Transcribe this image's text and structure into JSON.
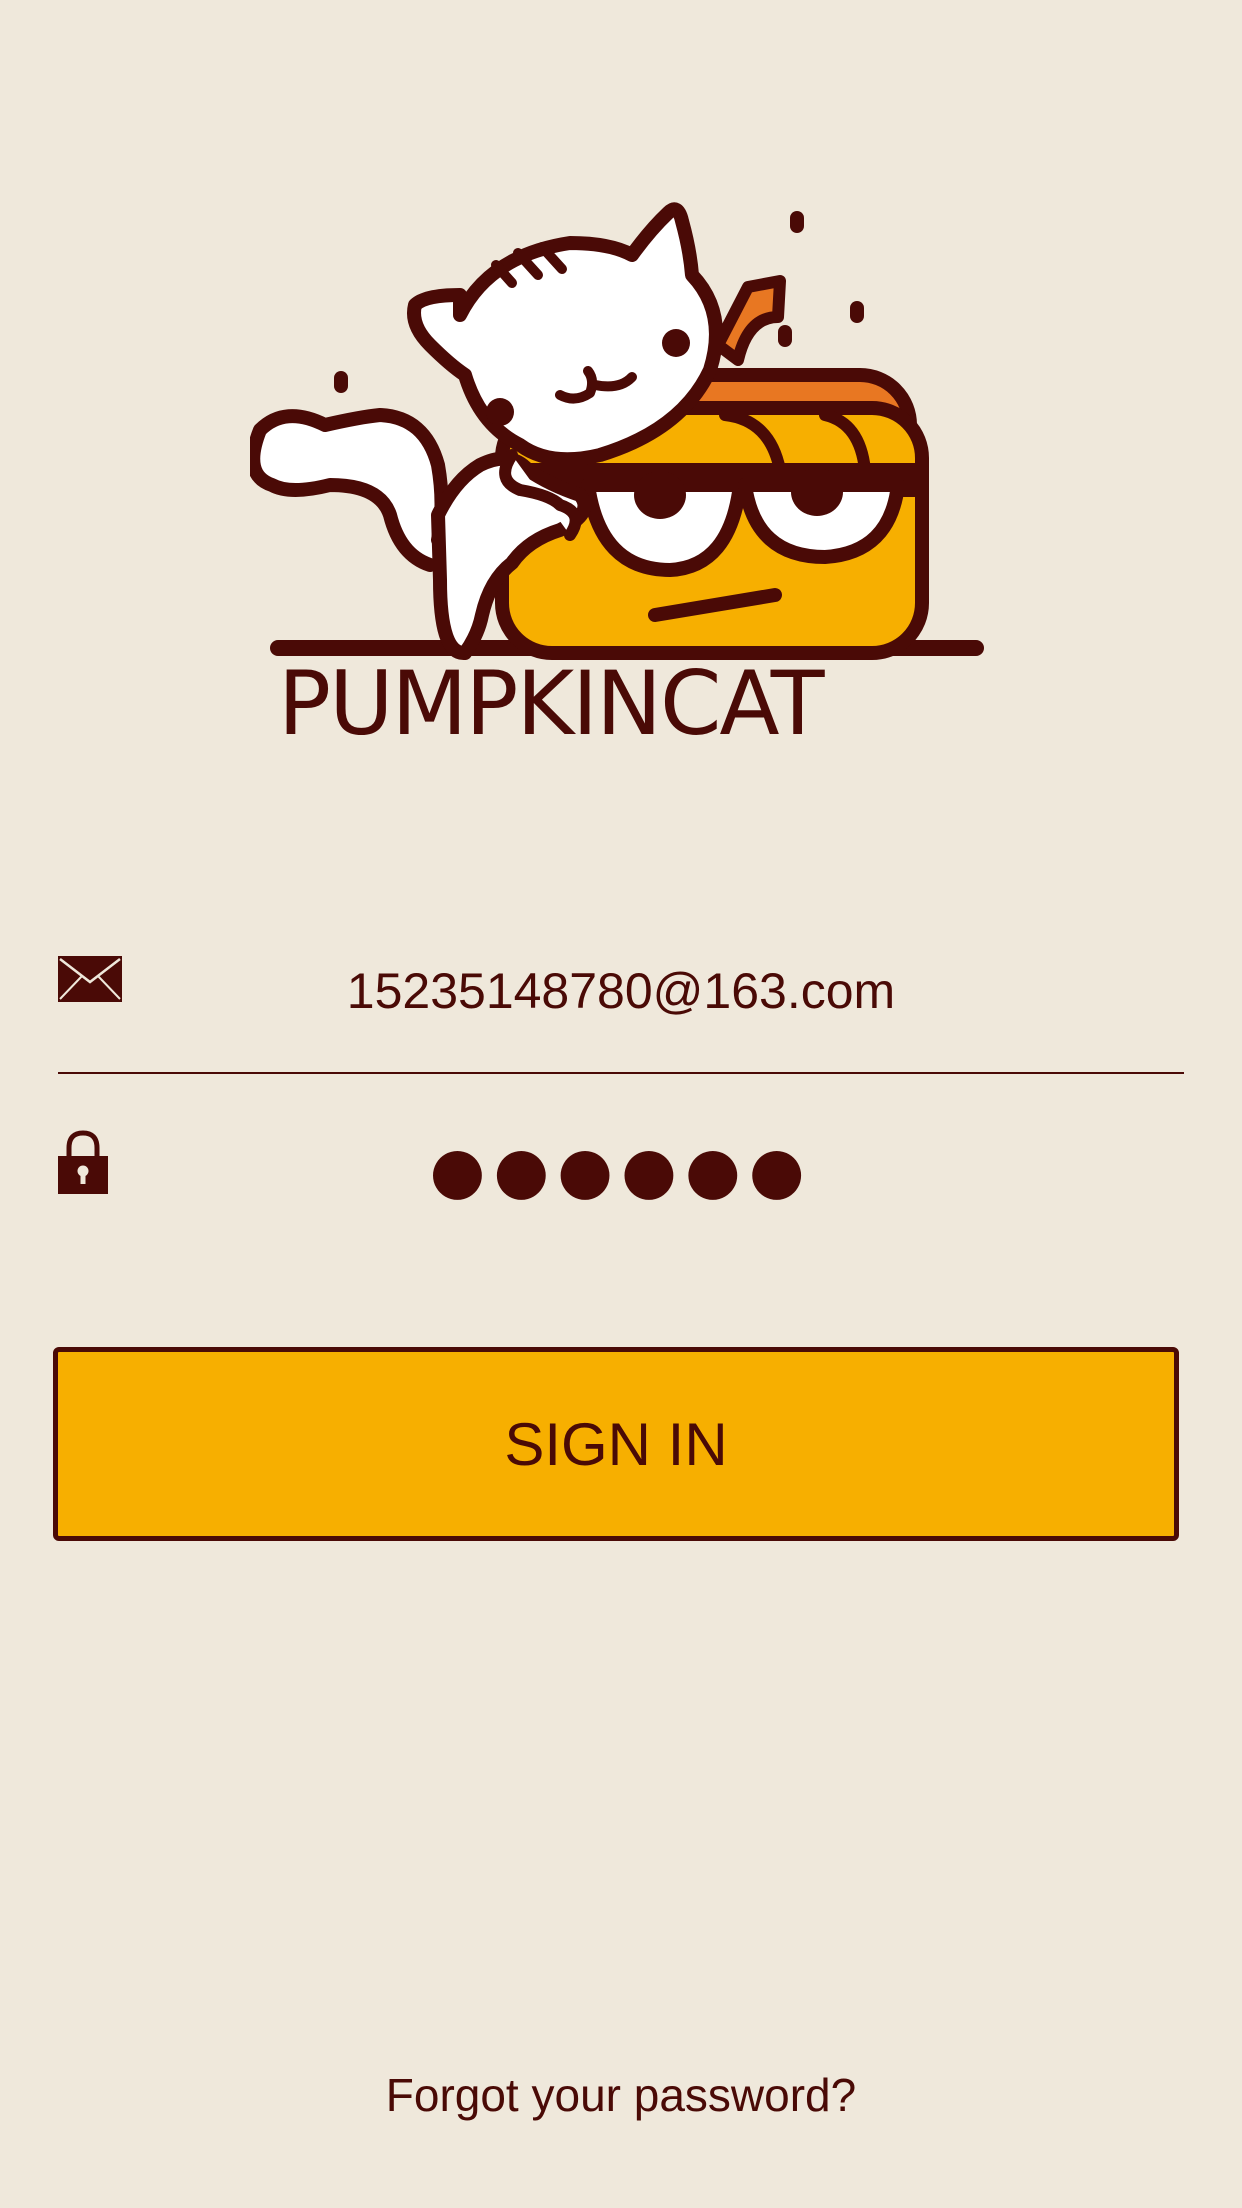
{
  "brand": {
    "logo_icon": "pumpkin-cat-logo",
    "name": "PUMPKINCAT"
  },
  "form": {
    "email": {
      "icon": "envelope-icon",
      "value": "15235148780@163.com"
    },
    "password": {
      "icon": "lock-icon",
      "value": "●●●●●●"
    },
    "signin_label": "SIGN IN",
    "forgot_label": "Forgot your password?"
  },
  "colors": {
    "background": "#efe8db",
    "primary": "#4a0a06",
    "accent": "#f7af00",
    "pumpkin_orange": "#e87722"
  }
}
